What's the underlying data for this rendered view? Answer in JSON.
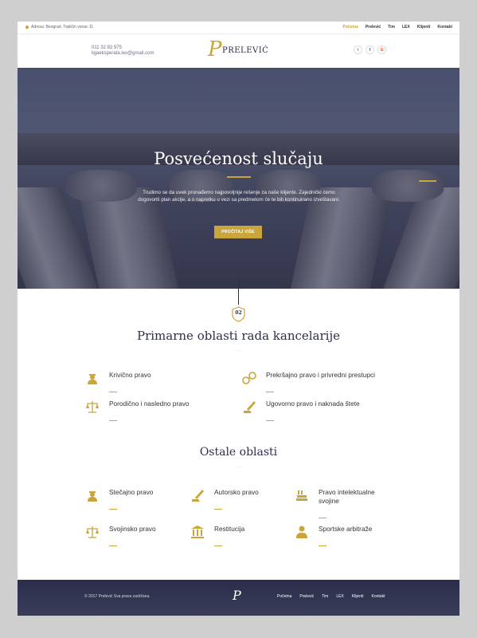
{
  "topbar": {
    "address": "Adresa: Beograd, Topličin venac 11",
    "nav": [
      "Početna",
      "Prelević",
      "Tim",
      "LEX",
      "Klijenti",
      "Kontakt"
    ]
  },
  "header": {
    "phone": "011 32 82 975",
    "email": "ligaeksperata.lex@gmail.com",
    "logo_letter": "P",
    "logo_name": "PRELEVIĆ",
    "social": [
      "t",
      "f",
      "G"
    ]
  },
  "hero": {
    "title": "Posvećenost slučaju",
    "text": "Trudimo se da uvek pronađemo najpovoljnije rešenje za naše klijente. Zajednički ćemo dogovoriti plan akcije, a o napretku u vezi sa predmetom će te biti kontinuirano izveštavani.",
    "button": "PROČITAJ VIŠE"
  },
  "badge": "02",
  "primary": {
    "title": "Primarne oblasti rada kancelarije",
    "dots": "...",
    "items": [
      {
        "label": "Krivično pravo",
        "icon": "judge-icon"
      },
      {
        "label": "Prekršajno pravo i privredni prestupci",
        "icon": "handcuffs-icon"
      },
      {
        "label": "Porodično i nasledno pravo",
        "icon": "scales-icon"
      },
      {
        "label": "Ugovorno pravo i naknada štete",
        "icon": "contract-icon"
      }
    ]
  },
  "other": {
    "title": "Ostale oblasti",
    "dots": "...",
    "items": [
      {
        "label": "Stečajno pravo",
        "icon": "judge-icon"
      },
      {
        "label": "Autorsko pravo",
        "icon": "contract-icon"
      },
      {
        "label": "Pravo intelektualne svojine",
        "icon": "books-icon"
      },
      {
        "label": "Svojinsko pravo",
        "icon": "scales-icon"
      },
      {
        "label": "Restitucija",
        "icon": "courthouse-icon"
      },
      {
        "label": "Sportske arbitraže",
        "icon": "person-icon"
      }
    ]
  },
  "footer": {
    "copyright": "© 2017 Prelević Sva prava zadržana.",
    "mark": "P",
    "nav": [
      "Početna",
      "Prelević",
      "Tim",
      "LEX",
      "Klijenti",
      "Kontakt"
    ]
  },
  "colors": {
    "accent": "#c9a53b",
    "navy": "#2c2f4a"
  }
}
